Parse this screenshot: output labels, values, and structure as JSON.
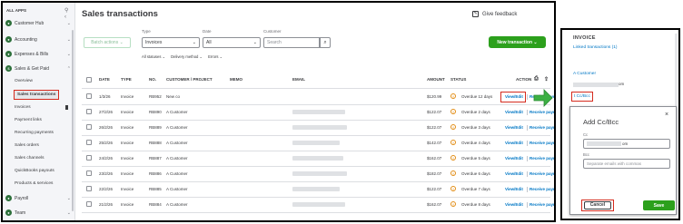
{
  "sidebar": {
    "heading": "ALL APPS",
    "sections": [
      {
        "label": "Customer Hub",
        "icon": "users-icon"
      },
      {
        "label": "Accounting",
        "icon": "ledger-icon"
      },
      {
        "label": "Expenses & Bills",
        "icon": "receipt-icon"
      },
      {
        "label": "Sales & Get Paid",
        "icon": "dollar-icon"
      }
    ],
    "sub_items": [
      "Overview",
      "Sales transactions",
      "Invoices",
      "Payment links",
      "Recurring payments",
      "Sales orders",
      "Sales channels",
      "QuickBooks payouts",
      "Products & services"
    ],
    "bottom_sections": [
      {
        "label": "Payroll",
        "icon": "payroll-icon"
      },
      {
        "label": "Team",
        "icon": "team-icon"
      }
    ]
  },
  "page": {
    "title": "Sales transactions",
    "give_feedback": "Give feedback"
  },
  "filters": {
    "batch_actions": "Batch actions",
    "type_label": "Type",
    "type_value": "Invoices",
    "date_label": "Date",
    "date_value": "All",
    "customer_label": "Customer",
    "search_placeholder": "Search",
    "new_transaction": "New transaction",
    "sub": [
      "All statuses",
      "Delivery method",
      "Errors"
    ]
  },
  "table": {
    "headers": {
      "date": "DATE",
      "type": "TYPE",
      "no": "NO.",
      "customer": "CUSTOMER / PROJECT",
      "memo": "MEMO",
      "email": "EMAIL",
      "amount": "AMOUNT",
      "status": "STATUS",
      "action": "ACTION"
    },
    "rows": [
      {
        "date": "1/3/26",
        "type": "Invoice",
        "no": "RB952",
        "customer": "New co",
        "amount": "$120.99",
        "status": "Overdue 12 days"
      },
      {
        "date": "27/2/26",
        "type": "Invoice",
        "no": "RB890",
        "customer": "A Customer",
        "amount": "$122.07",
        "status": "Overdue 2 days"
      },
      {
        "date": "26/2/26",
        "type": "Invoice",
        "no": "RB889",
        "customer": "A Customer",
        "amount": "$122.07",
        "status": "Overdue 3 days"
      },
      {
        "date": "25/2/26",
        "type": "Invoice",
        "no": "RB888",
        "customer": "A Customer",
        "amount": "$142.07",
        "status": "Overdue 4 days"
      },
      {
        "date": "24/2/26",
        "type": "Invoice",
        "no": "RB887",
        "customer": "A Customer",
        "amount": "$162.07",
        "status": "Overdue 5 days"
      },
      {
        "date": "23/2/26",
        "type": "Invoice",
        "no": "RB886",
        "customer": "A Customer",
        "amount": "$182.07",
        "status": "Overdue 6 days"
      },
      {
        "date": "22/2/26",
        "type": "Invoice",
        "no": "RB885",
        "customer": "A Customer",
        "amount": "$122.07",
        "status": "Overdue 7 days"
      },
      {
        "date": "21/2/26",
        "type": "Invoice",
        "no": "RB884",
        "customer": "A Customer",
        "amount": "$162.07",
        "status": "Overdue 8 days"
      }
    ],
    "view_edit": "View/Edit",
    "receive_payment": "Receive payn"
  },
  "invoice_panel": {
    "title": "INVOICE",
    "linked": "Linked transactions (1)",
    "customer": "A Customer",
    "email_suffix": "om",
    "cc_bcc_link": "t Cc/Bcc"
  },
  "dialog": {
    "title": "Add Cc/Bcc",
    "cc_label": "Cc",
    "cc_value_suffix": "om",
    "bcc_label": "Bcc",
    "bcc_placeholder": "Separate emails with commas",
    "cancel": "Cancel",
    "save": "Save"
  },
  "colors": {
    "brand_green": "#2ca01c",
    "link_blue": "#0077c5",
    "highlight_red": "#d52b1e",
    "overdue_orange": "#e28d15"
  }
}
